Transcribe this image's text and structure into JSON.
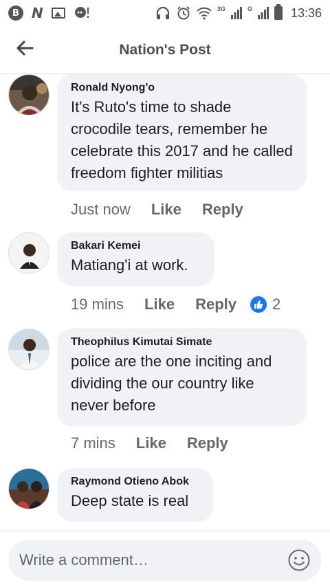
{
  "status_bar": {
    "time": "13:36",
    "network_3g": "3G",
    "network_g": "G"
  },
  "header": {
    "title": "Nation's Post"
  },
  "comments": [
    {
      "author": "Ronald Nyong'o",
      "text": "It's Ruto's time to shade crocodile tears, remember he celebrate this 2017 and he called freedom fighter militias",
      "time": "Just now",
      "like": "Like",
      "reply": "Reply"
    },
    {
      "author": "Bakari Kemei",
      "text": "Matiang'i at work.",
      "time": "19 mins",
      "like": "Like",
      "reply": "Reply",
      "reaction_count": "2"
    },
    {
      "author": "Theophilus Kimutai Simate",
      "text": "police are the one inciting and dividing the our country like never before",
      "time": "7 mins",
      "like": "Like",
      "reply": "Reply"
    },
    {
      "author": "Raymond Otieno Abok",
      "text": "Deep state is real"
    }
  ],
  "composer": {
    "placeholder": "Write a comment…"
  },
  "icons": {
    "back": "arrow-left-icon",
    "emoji": "smiley-icon",
    "reaction": "thumbs-up-icon"
  },
  "colors": {
    "bubble": "#f0f2f5",
    "like_blue": "#1877f2",
    "meta_text": "#65676b"
  }
}
